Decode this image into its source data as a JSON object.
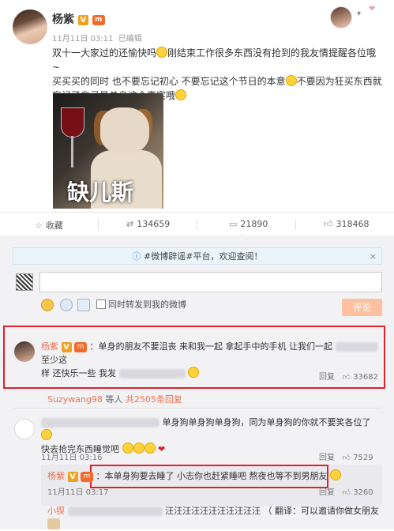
{
  "post": {
    "author": "杨紫",
    "v_badge": "V",
    "level_badge": "m",
    "time": "11月11日 03:11",
    "edited": "已编辑",
    "text_line1": "双十一大家过的还愉快吗",
    "text_line1b": "刚结束工作很多东西没有抢到的我友情提醒各位哦~",
    "text_line2": "买买买的同时 也不要忘记初心 不要忘记这个节日的本意",
    "text_line2b": "不要因为狂买东西就",
    "text_line3": "忘记了自己是单身这个事实哦",
    "image_caption": "缺儿斯",
    "image_alt": "dog with wine glass meme"
  },
  "actions": {
    "favorite": "收藏",
    "repost": "134659",
    "comment": "21890",
    "like": "318468"
  },
  "notice": {
    "text": "#微博辟谣#平台，欢迎查阅！",
    "close": "×"
  },
  "compose": {
    "placeholder": "",
    "sync_label": "同时转发到我的微博",
    "submit": "评论"
  },
  "comments": [
    {
      "author": "杨紫",
      "text_a": "：单身的朋友不要沮丧 来和我一起 拿起手中的手机 让我们一起",
      "text_b": "至少这",
      "text_c": "样 还快乐一些 我发",
      "reply": "回复",
      "likes": "33682"
    },
    {
      "more_user": "Suzywang98",
      "more_text": "等人",
      "more_count": "共2505条回复"
    },
    {
      "author_blur": true,
      "text_a": "单身狗单身狗单身狗，同为单身狗的你就不要笑各位了",
      "text_b": "快去抢完东西睡觉吧",
      "time": "11月11日 03:16",
      "reply": "回复",
      "likes": "7529"
    },
    {
      "author": "杨紫",
      "text": "：本单身狗要去睡了 小志你也赶紧睡吧 熬夜也等不到男朋友",
      "time": "11月11日 03:17",
      "reply": "回复",
      "likes": "3260"
    },
    {
      "author": "小猰",
      "text": "汪汪汪汪汪汪汪汪汪汪汪 （ 翻译：可以邀请你做女朋友吗"
    }
  ]
}
